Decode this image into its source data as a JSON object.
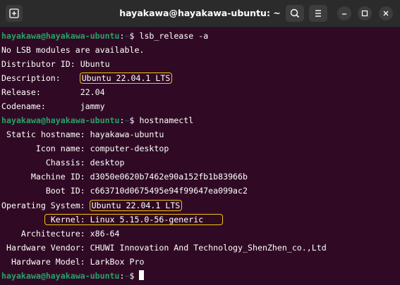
{
  "window": {
    "title": "hayakawa@hayakawa-ubuntu: ~"
  },
  "icons": [
    "new-tab-icon",
    "search-icon",
    "menu-icon",
    "minimize-icon",
    "maximize-icon",
    "close-icon"
  ],
  "prompt": {
    "user_host": "hayakawa@hayakawa-ubuntu",
    "colon": ":",
    "path": "~",
    "dollar": "$ "
  },
  "commands": {
    "lsb": "lsb_release -a",
    "hostnamectl": "hostnamectl"
  },
  "lsb_output": {
    "no_modules": "No LSB modules are available.",
    "distributor_label": "Distributor ID:\t",
    "distributor_value": "Ubuntu",
    "description_label": "Description:    ",
    "description_value": "Ubuntu 22.04.1 LTS",
    "release_label": "Release:        ",
    "release_value": "22.04",
    "codename_label": "Codename:       ",
    "codename_value": "jammy"
  },
  "hostnamectl_output": {
    "static_hostname": " Static hostname: hayakawa-ubuntu",
    "icon_name": "       Icon name: computer-desktop",
    "chassis": "         Chassis: desktop",
    "machine_id": "      Machine ID: d3050e0620b7462e90a152fb1b83966b",
    "boot_id": "         Boot ID: c663710d0675495e94f99647ea099ac2",
    "os_label": "Operating System: ",
    "os_value": "Ubuntu 22.04.1 LTS",
    "kernel_label": "Kernel: Linux 5.15.0-56-generic",
    "kernel_indent": "          ",
    "architecture": "    Architecture: x86-64",
    "vendor": " Hardware Vendor: CHUWI Innovation And Technology_ShenZhen_co.,Ltd",
    "model": "  Hardware Model: LarkBox Pro"
  },
  "colors": {
    "background": "#300a24",
    "prompt_user": "#26a269",
    "prompt_path": "#12488b",
    "highlight": "#f5c211"
  }
}
